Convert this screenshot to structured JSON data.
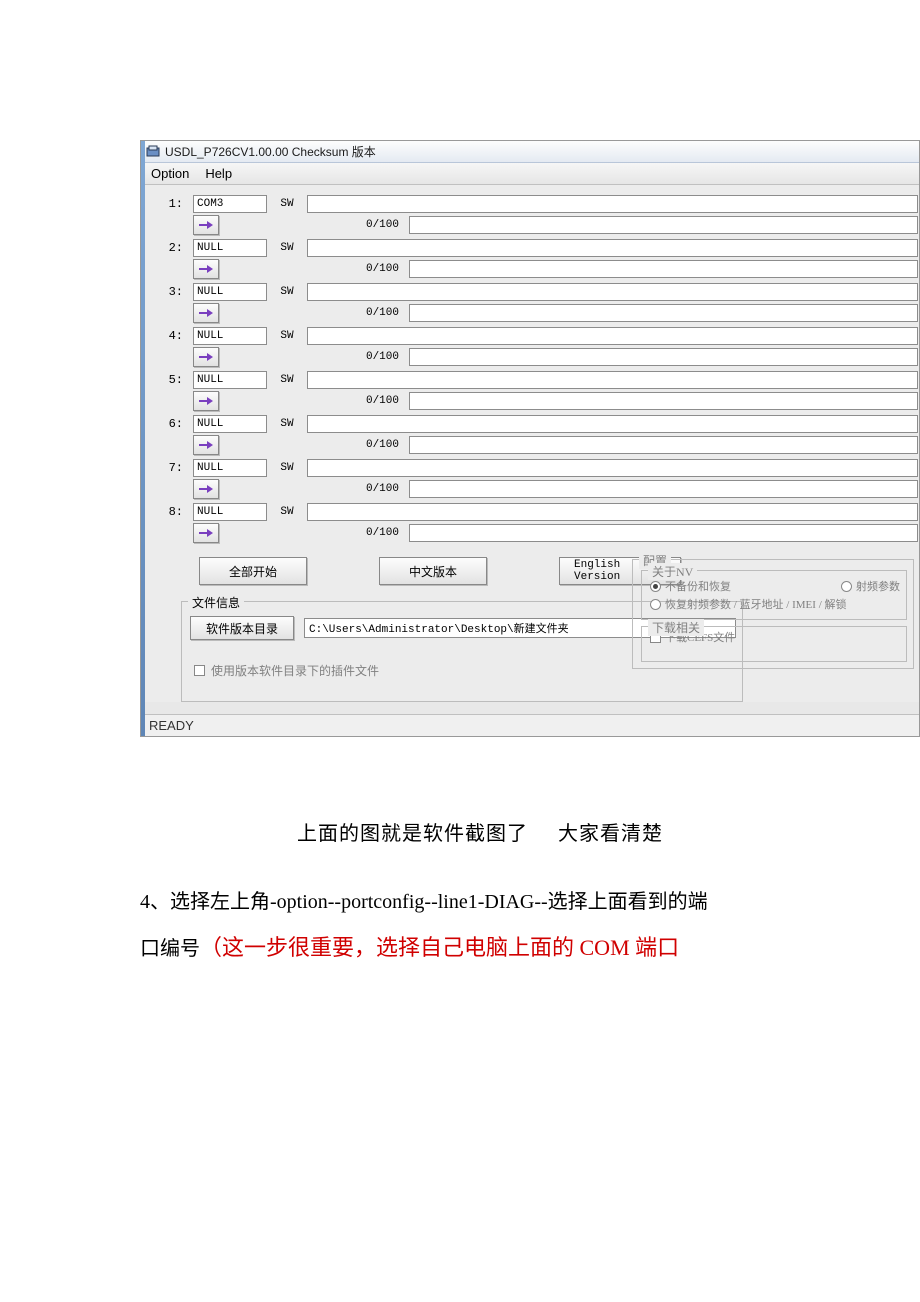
{
  "window": {
    "title": "USDL_P726CV1.00.00 Checksum 版本"
  },
  "menu": {
    "option": "Option",
    "help": "Help"
  },
  "ports": [
    {
      "idx": "1:",
      "port": "COM3",
      "sw": "SW",
      "progress": "0/100"
    },
    {
      "idx": "2:",
      "port": "NULL",
      "sw": "SW",
      "progress": "0/100"
    },
    {
      "idx": "3:",
      "port": "NULL",
      "sw": "SW",
      "progress": "0/100"
    },
    {
      "idx": "4:",
      "port": "NULL",
      "sw": "SW",
      "progress": "0/100"
    },
    {
      "idx": "5:",
      "port": "NULL",
      "sw": "SW",
      "progress": "0/100"
    },
    {
      "idx": "6:",
      "port": "NULL",
      "sw": "SW",
      "progress": "0/100"
    },
    {
      "idx": "7:",
      "port": "NULL",
      "sw": "SW",
      "progress": "0/100"
    },
    {
      "idx": "8:",
      "port": "NULL",
      "sw": "SW",
      "progress": "0/100"
    }
  ],
  "buttons": {
    "start_all": "全部开始",
    "cn_version": "中文版本",
    "en_version": "English Version",
    "sw_dir": "软件版本目录"
  },
  "config": {
    "legend": "配置",
    "nv_legend": "关于NV",
    "nv_none": "不备份和恢复",
    "nv_rf": "射频参数",
    "nv_restore": "恢复射频参数 / 蓝牙地址 / IMEI / 解锁",
    "dl_legend": "下载相关",
    "dl_cefs": "下载CEFS文件"
  },
  "file": {
    "legend": "文件信息",
    "path": "C:\\Users\\Administrator\\Desktop\\新建文件夹",
    "checkbox": "使用版本软件目录下的插件文件"
  },
  "status": {
    "ready": "READY"
  },
  "caption": {
    "line1": "上面的图就是软件截图了 大家看清楚",
    "line2a": "4、选择左上角-option--portconfig--line1-DIAG--选择上面看到的端",
    "line2b": "口编号",
    "line2c": "（这一步很重要，选择自己电脑上面的 COM 端口"
  }
}
